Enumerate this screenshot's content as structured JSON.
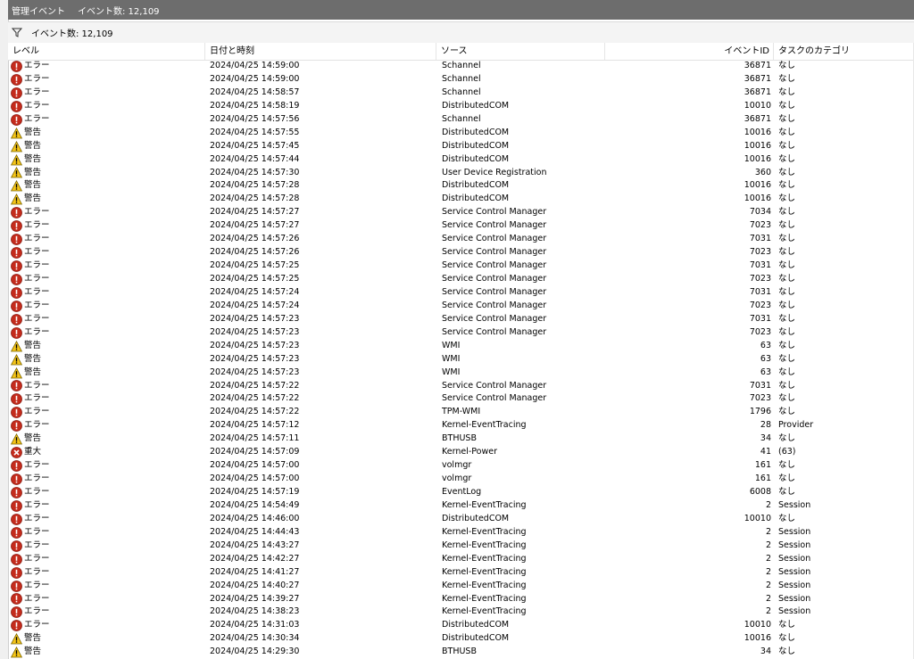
{
  "title": {
    "name": "管理イベント",
    "count": "イベント数: 12,109"
  },
  "filter": {
    "label": "イベント数: 12,109"
  },
  "columns": {
    "level": "レベル",
    "date": "日付と時刻",
    "source": "ソース",
    "event_id": "イベントID",
    "category": "タスクのカテゴリ"
  },
  "rows": [
    {
      "type": "error",
      "level": "エラー",
      "date": "2024/04/25 14:59:00",
      "source": "Schannel",
      "id": "36871",
      "cat": "なし"
    },
    {
      "type": "error",
      "level": "エラー",
      "date": "2024/04/25 14:59:00",
      "source": "Schannel",
      "id": "36871",
      "cat": "なし"
    },
    {
      "type": "error",
      "level": "エラー",
      "date": "2024/04/25 14:58:57",
      "source": "Schannel",
      "id": "36871",
      "cat": "なし"
    },
    {
      "type": "error",
      "level": "エラー",
      "date": "2024/04/25 14:58:19",
      "source": "DistributedCOM",
      "id": "10010",
      "cat": "なし"
    },
    {
      "type": "error",
      "level": "エラー",
      "date": "2024/04/25 14:57:56",
      "source": "Schannel",
      "id": "36871",
      "cat": "なし"
    },
    {
      "type": "warning",
      "level": "警告",
      "date": "2024/04/25 14:57:55",
      "source": "DistributedCOM",
      "id": "10016",
      "cat": "なし"
    },
    {
      "type": "warning",
      "level": "警告",
      "date": "2024/04/25 14:57:45",
      "source": "DistributedCOM",
      "id": "10016",
      "cat": "なし"
    },
    {
      "type": "warning",
      "level": "警告",
      "date": "2024/04/25 14:57:44",
      "source": "DistributedCOM",
      "id": "10016",
      "cat": "なし"
    },
    {
      "type": "warning",
      "level": "警告",
      "date": "2024/04/25 14:57:30",
      "source": "User Device Registration",
      "id": "360",
      "cat": "なし"
    },
    {
      "type": "warning",
      "level": "警告",
      "date": "2024/04/25 14:57:28",
      "source": "DistributedCOM",
      "id": "10016",
      "cat": "なし"
    },
    {
      "type": "warning",
      "level": "警告",
      "date": "2024/04/25 14:57:28",
      "source": "DistributedCOM",
      "id": "10016",
      "cat": "なし"
    },
    {
      "type": "error",
      "level": "エラー",
      "date": "2024/04/25 14:57:27",
      "source": "Service Control Manager",
      "id": "7034",
      "cat": "なし"
    },
    {
      "type": "error",
      "level": "エラー",
      "date": "2024/04/25 14:57:27",
      "source": "Service Control Manager",
      "id": "7023",
      "cat": "なし"
    },
    {
      "type": "error",
      "level": "エラー",
      "date": "2024/04/25 14:57:26",
      "source": "Service Control Manager",
      "id": "7031",
      "cat": "なし"
    },
    {
      "type": "error",
      "level": "エラー",
      "date": "2024/04/25 14:57:26",
      "source": "Service Control Manager",
      "id": "7023",
      "cat": "なし"
    },
    {
      "type": "error",
      "level": "エラー",
      "date": "2024/04/25 14:57:25",
      "source": "Service Control Manager",
      "id": "7031",
      "cat": "なし"
    },
    {
      "type": "error",
      "level": "エラー",
      "date": "2024/04/25 14:57:25",
      "source": "Service Control Manager",
      "id": "7023",
      "cat": "なし"
    },
    {
      "type": "error",
      "level": "エラー",
      "date": "2024/04/25 14:57:24",
      "source": "Service Control Manager",
      "id": "7031",
      "cat": "なし"
    },
    {
      "type": "error",
      "level": "エラー",
      "date": "2024/04/25 14:57:24",
      "source": "Service Control Manager",
      "id": "7023",
      "cat": "なし"
    },
    {
      "type": "error",
      "level": "エラー",
      "date": "2024/04/25 14:57:23",
      "source": "Service Control Manager",
      "id": "7031",
      "cat": "なし"
    },
    {
      "type": "error",
      "level": "エラー",
      "date": "2024/04/25 14:57:23",
      "source": "Service Control Manager",
      "id": "7023",
      "cat": "なし"
    },
    {
      "type": "warning",
      "level": "警告",
      "date": "2024/04/25 14:57:23",
      "source": "WMI",
      "id": "63",
      "cat": "なし"
    },
    {
      "type": "warning",
      "level": "警告",
      "date": "2024/04/25 14:57:23",
      "source": "WMI",
      "id": "63",
      "cat": "なし"
    },
    {
      "type": "warning",
      "level": "警告",
      "date": "2024/04/25 14:57:23",
      "source": "WMI",
      "id": "63",
      "cat": "なし"
    },
    {
      "type": "error",
      "level": "エラー",
      "date": "2024/04/25 14:57:22",
      "source": "Service Control Manager",
      "id": "7031",
      "cat": "なし"
    },
    {
      "type": "error",
      "level": "エラー",
      "date": "2024/04/25 14:57:22",
      "source": "Service Control Manager",
      "id": "7023",
      "cat": "なし"
    },
    {
      "type": "error",
      "level": "エラー",
      "date": "2024/04/25 14:57:22",
      "source": "TPM-WMI",
      "id": "1796",
      "cat": "なし"
    },
    {
      "type": "error",
      "level": "エラー",
      "date": "2024/04/25 14:57:12",
      "source": "Kernel-EventTracing",
      "id": "28",
      "cat": "Provider"
    },
    {
      "type": "warning",
      "level": "警告",
      "date": "2024/04/25 14:57:11",
      "source": "BTHUSB",
      "id": "34",
      "cat": "なし"
    },
    {
      "type": "critical",
      "level": "重大",
      "date": "2024/04/25 14:57:09",
      "source": "Kernel-Power",
      "id": "41",
      "cat": "(63)"
    },
    {
      "type": "error",
      "level": "エラー",
      "date": "2024/04/25 14:57:00",
      "source": "volmgr",
      "id": "161",
      "cat": "なし"
    },
    {
      "type": "error",
      "level": "エラー",
      "date": "2024/04/25 14:57:00",
      "source": "volmgr",
      "id": "161",
      "cat": "なし"
    },
    {
      "type": "error",
      "level": "エラー",
      "date": "2024/04/25 14:57:19",
      "source": "EventLog",
      "id": "6008",
      "cat": "なし"
    },
    {
      "type": "error",
      "level": "エラー",
      "date": "2024/04/25 14:54:49",
      "source": "Kernel-EventTracing",
      "id": "2",
      "cat": "Session"
    },
    {
      "type": "error",
      "level": "エラー",
      "date": "2024/04/25 14:46:00",
      "source": "DistributedCOM",
      "id": "10010",
      "cat": "なし"
    },
    {
      "type": "error",
      "level": "エラー",
      "date": "2024/04/25 14:44:43",
      "source": "Kernel-EventTracing",
      "id": "2",
      "cat": "Session"
    },
    {
      "type": "error",
      "level": "エラー",
      "date": "2024/04/25 14:43:27",
      "source": "Kernel-EventTracing",
      "id": "2",
      "cat": "Session"
    },
    {
      "type": "error",
      "level": "エラー",
      "date": "2024/04/25 14:42:27",
      "source": "Kernel-EventTracing",
      "id": "2",
      "cat": "Session"
    },
    {
      "type": "error",
      "level": "エラー",
      "date": "2024/04/25 14:41:27",
      "source": "Kernel-EventTracing",
      "id": "2",
      "cat": "Session"
    },
    {
      "type": "error",
      "level": "エラー",
      "date": "2024/04/25 14:40:27",
      "source": "Kernel-EventTracing",
      "id": "2",
      "cat": "Session"
    },
    {
      "type": "error",
      "level": "エラー",
      "date": "2024/04/25 14:39:27",
      "source": "Kernel-EventTracing",
      "id": "2",
      "cat": "Session"
    },
    {
      "type": "error",
      "level": "エラー",
      "date": "2024/04/25 14:38:23",
      "source": "Kernel-EventTracing",
      "id": "2",
      "cat": "Session"
    },
    {
      "type": "error",
      "level": "エラー",
      "date": "2024/04/25 14:31:03",
      "source": "DistributedCOM",
      "id": "10010",
      "cat": "なし"
    },
    {
      "type": "warning",
      "level": "警告",
      "date": "2024/04/25 14:30:34",
      "source": "DistributedCOM",
      "id": "10016",
      "cat": "なし"
    },
    {
      "type": "warning",
      "level": "警告",
      "date": "2024/04/25 14:29:30",
      "source": "BTHUSB",
      "id": "34",
      "cat": "なし"
    }
  ]
}
